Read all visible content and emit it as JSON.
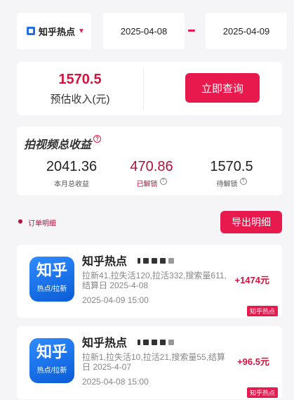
{
  "filter": {
    "platform": "知乎热点",
    "date_start": "2025-04-08",
    "date_end": "2025-04-09"
  },
  "income": {
    "value": "1570.5",
    "label": "预估收入(元)",
    "query_button": "立即查询"
  },
  "revenue": {
    "title": "拍视频总收益",
    "help_icon": "question-icon",
    "stats": [
      {
        "value": "2041.36",
        "label": "本月总收益"
      },
      {
        "value": "470.86",
        "label": "已解锁"
      },
      {
        "value": "1570.5",
        "label": "待解锁"
      }
    ]
  },
  "orders": {
    "title": "订单明细",
    "export_button": "导出明细",
    "items": [
      {
        "logo_big": "知乎",
        "logo_small": "热点/拉新",
        "name": "知乎热点",
        "detail": "拉新41,拉失活120,拉活332,搜索量611,结算日 2025-4-08",
        "amount": "+1474元",
        "time": "2025-04-09 15:00",
        "tag": "知乎热点"
      },
      {
        "logo_big": "知乎",
        "logo_small": "热点/拉新",
        "name": "知乎热点",
        "detail": "拉新1,拉失活10,拉活21,搜索量55,结算日 2025-4-07",
        "amount": "+96.5元",
        "time": "2025-04-08 15:00",
        "tag": "知乎热点"
      }
    ]
  },
  "colors": {
    "accent": "#e8194c",
    "value_red": "#d2143f",
    "dark_red": "#b0123d",
    "logo_blue": "#1f6fe8"
  }
}
